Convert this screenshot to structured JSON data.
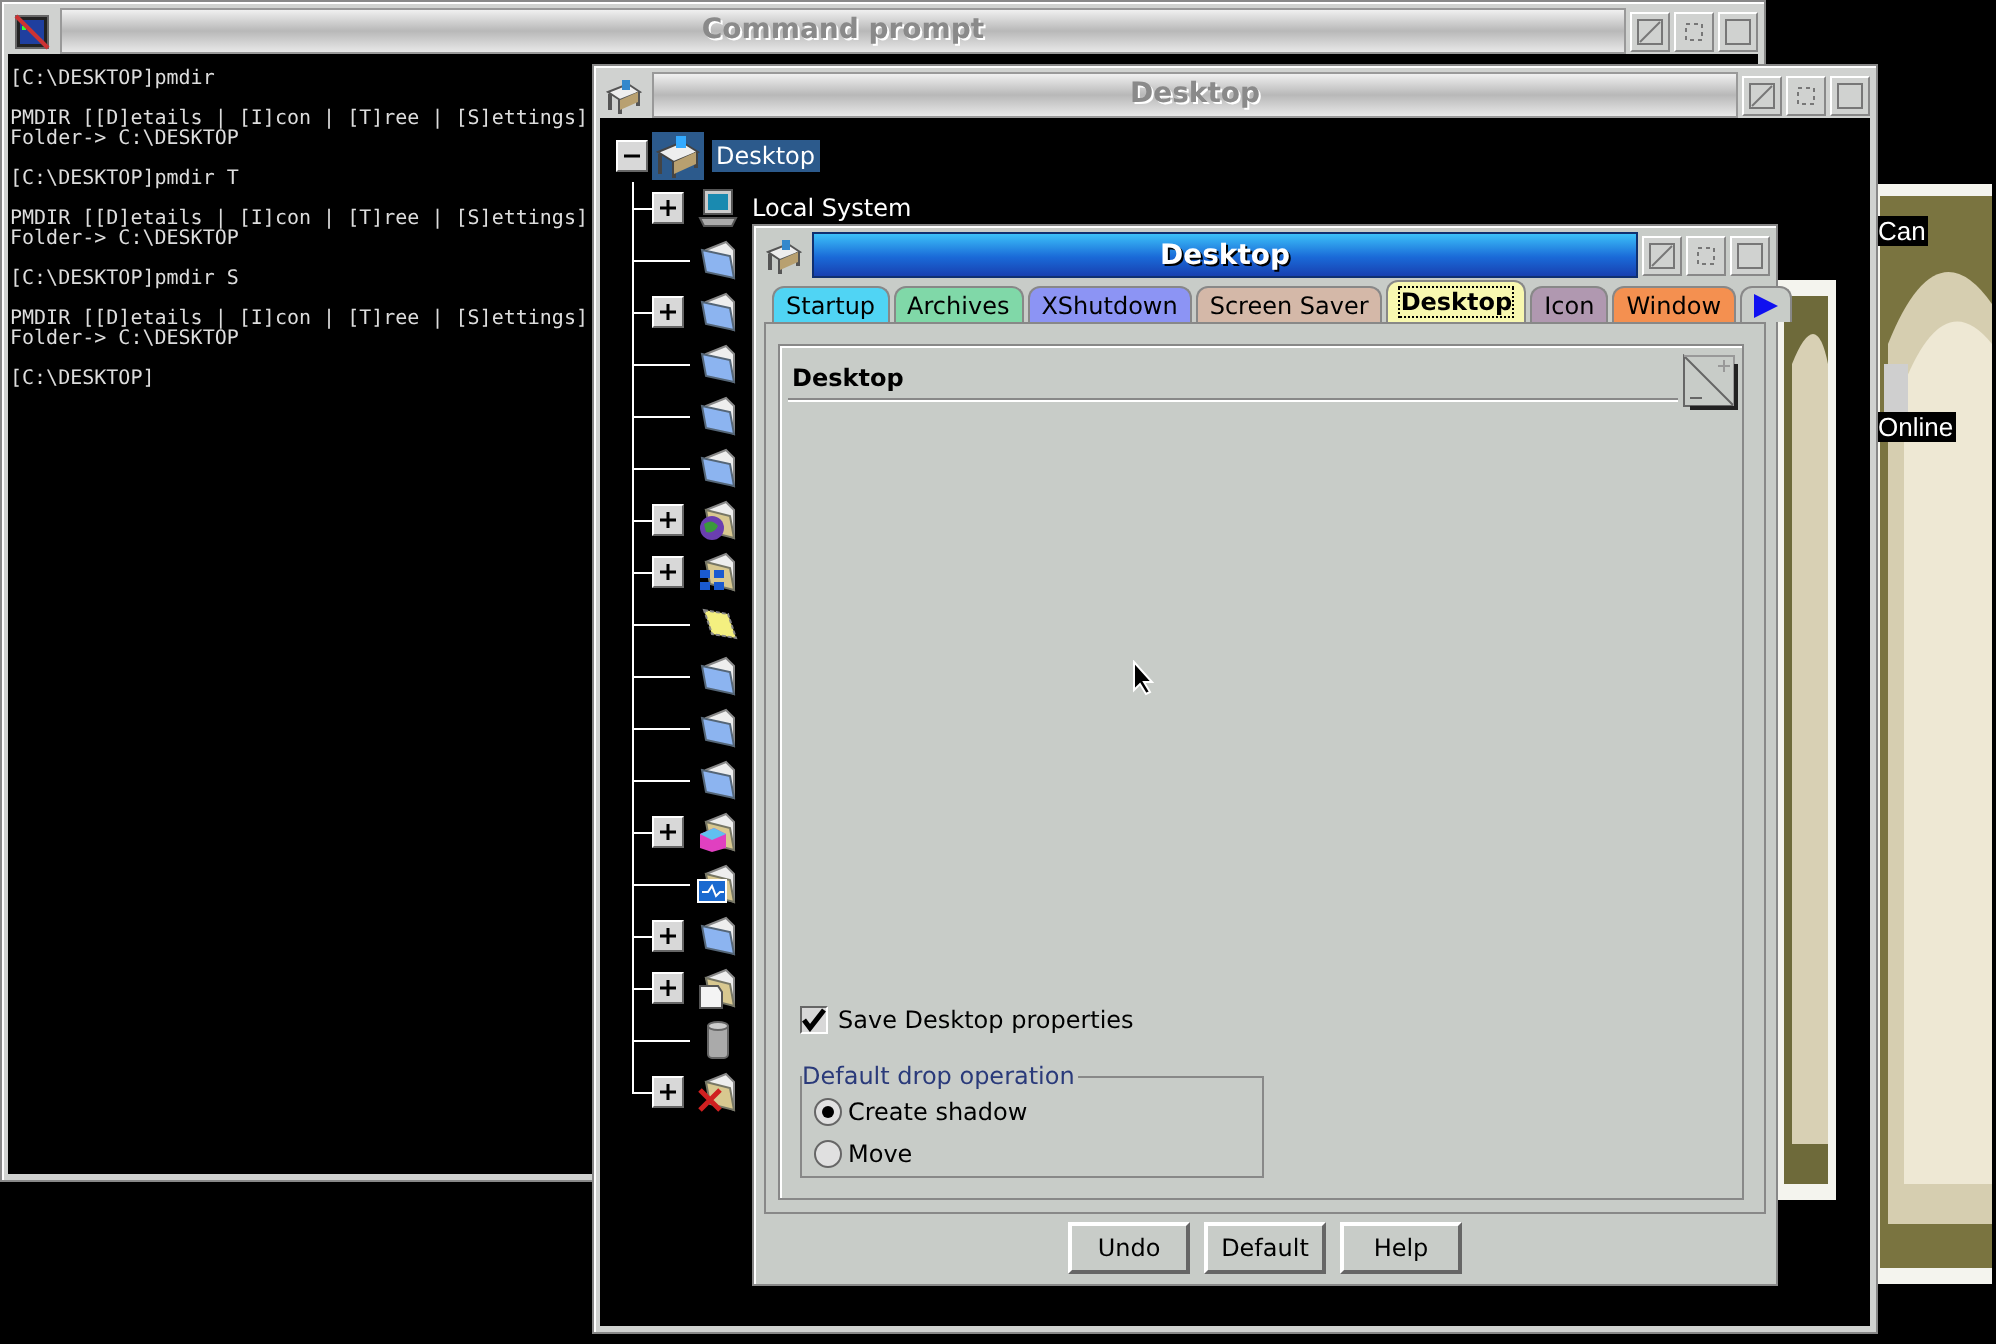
{
  "command_prompt": {
    "title": "Command prompt",
    "output": [
      {
        "lines": [
          "[C:\\DESKTOP]pmdir"
        ]
      },
      {
        "lines": [
          "PMDIR [[D]etails | [I]con | [T]ree | [S]ettings]",
          "Folder-> C:\\DESKTOP"
        ]
      },
      {
        "lines": [
          "[C:\\DESKTOP]pmdir T"
        ]
      },
      {
        "lines": [
          "PMDIR [[D]etails | [I]con | [T]ree | [S]ettings]",
          "Folder-> C:\\DESKTOP"
        ]
      },
      {
        "lines": [
          "[C:\\DESKTOP]pmdir S"
        ]
      },
      {
        "lines": [
          "PMDIR [[D]etails | [I]con | [T]ree | [S]ettings]",
          "Folder-> C:\\DESKTOP"
        ]
      },
      {
        "lines": [
          "[C:\\DESKTOP]"
        ]
      }
    ]
  },
  "background_window": {
    "texts": [
      "Can",
      "Online"
    ]
  },
  "folder_window": {
    "title": "Desktop",
    "tree": {
      "label": "Desktop",
      "expanded": true,
      "selected": true,
      "children": [
        {
          "label": "Local System",
          "kind": "computer",
          "expandable": true
        },
        {
          "kind": "folder",
          "expandable": false
        },
        {
          "kind": "folder",
          "expandable": true
        },
        {
          "kind": "folder",
          "expandable": false
        },
        {
          "kind": "folder",
          "expandable": false
        },
        {
          "kind": "folder",
          "expandable": false
        },
        {
          "kind": "globe",
          "expandable": true
        },
        {
          "kind": "network",
          "expandable": true
        },
        {
          "kind": "template",
          "expandable": false
        },
        {
          "kind": "folder",
          "expandable": false
        },
        {
          "kind": "folder",
          "expandable": false
        },
        {
          "kind": "folder",
          "expandable": false
        },
        {
          "kind": "package",
          "expandable": true
        },
        {
          "kind": "monitor",
          "expandable": false
        },
        {
          "kind": "folder",
          "expandable": true
        },
        {
          "kind": "document",
          "expandable": true
        },
        {
          "kind": "trash",
          "expandable": false
        },
        {
          "kind": "cross",
          "expandable": true
        }
      ]
    }
  },
  "settings_window": {
    "title": "Desktop",
    "tabs": [
      {
        "label": "Startup",
        "color": "#50d4f4",
        "selected": false
      },
      {
        "label": "Archives",
        "color": "#80d8a8",
        "selected": false
      },
      {
        "label": "XShutdown",
        "color": "#8c94f4",
        "selected": false
      },
      {
        "label": "Screen Saver",
        "color": "#d4b8a8",
        "selected": false
      },
      {
        "label": "Desktop",
        "color": "#f8f8b0",
        "selected": true
      },
      {
        "label": "Icon",
        "color": "#b098b0",
        "selected": false
      },
      {
        "label": "Window",
        "color": "#f49050",
        "selected": false
      }
    ],
    "page": {
      "heading": "Desktop",
      "save_properties": {
        "label": "Save Desktop properties",
        "checked": true
      },
      "drop_operation": {
        "title": "Default drop operation",
        "options": [
          {
            "label": "Create shadow",
            "selected": true
          },
          {
            "label": "Move",
            "selected": false
          }
        ]
      }
    },
    "buttons": [
      "Undo",
      "Default",
      "Help"
    ]
  }
}
